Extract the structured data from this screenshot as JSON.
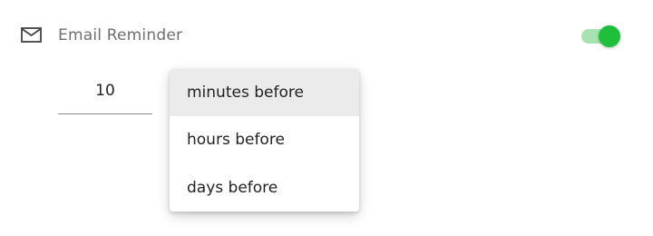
{
  "reminder": {
    "title": "Email Reminder",
    "icon": "mail-icon",
    "enabled": true,
    "toggle_colors": {
      "track": "#a6e3b0",
      "thumb": "#1fbf3c"
    }
  },
  "amount": {
    "value": "10"
  },
  "unit_menu": {
    "selected_index": 0,
    "options": [
      {
        "label": "minutes before"
      },
      {
        "label": "hours before"
      },
      {
        "label": "days before"
      }
    ]
  }
}
